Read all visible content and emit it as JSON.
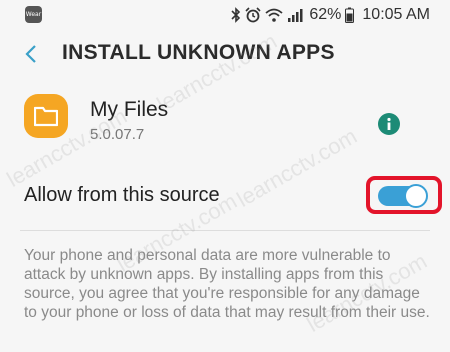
{
  "status_bar": {
    "wear_label": "Wear",
    "battery": "62%",
    "time": "10:05 AM",
    "icons": [
      "bluetooth-icon",
      "alarm-icon",
      "wifi-icon",
      "signal-icon",
      "battery-icon"
    ]
  },
  "header": {
    "title": "INSTALL UNKNOWN APPS"
  },
  "app": {
    "name": "My Files",
    "version": "5.0.07.7",
    "icon": "folder-icon",
    "icon_color": "#f5a623"
  },
  "allow": {
    "label": "Allow from this source",
    "enabled": true,
    "toggle_color": "#3aa0d6",
    "highlight_color": "#e3142a"
  },
  "warning": {
    "text": "Your phone and personal data are more vulnerable to attack by unknown apps. By installing apps from this source, you agree that you're responsible for any damage to your phone or loss of data that may result from their use."
  },
  "watermark": "learncctv.com"
}
